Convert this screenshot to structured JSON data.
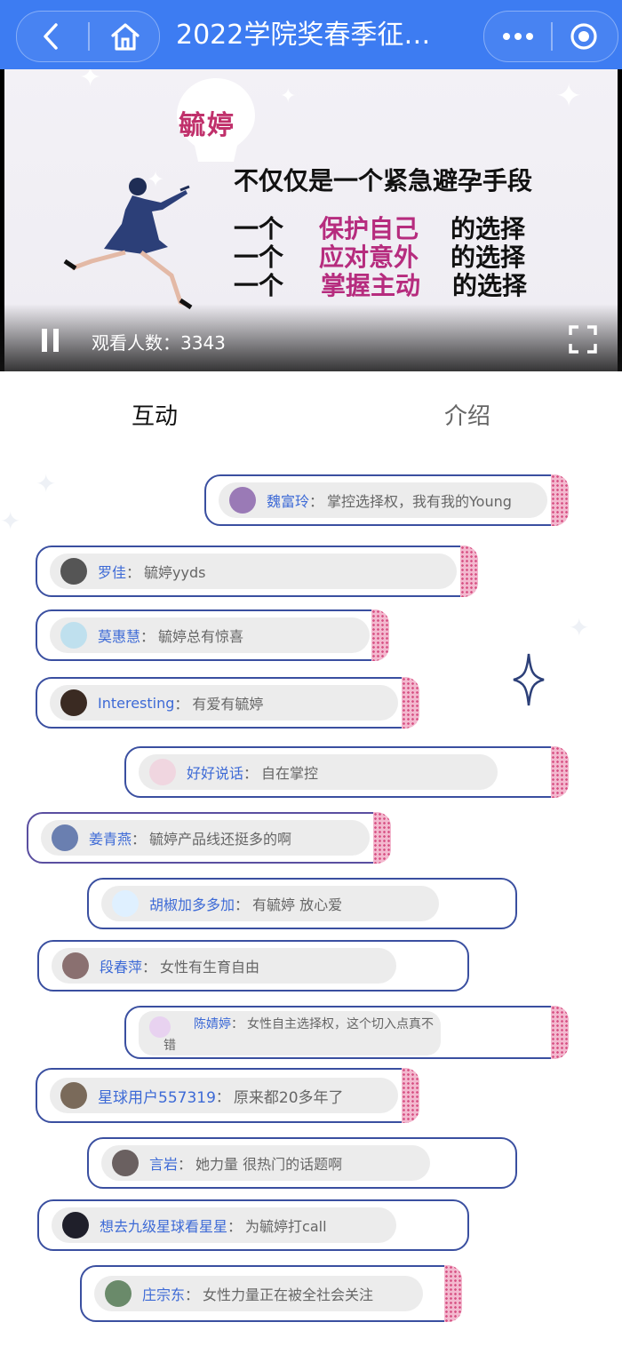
{
  "header": {
    "title": "2022学院奖春季征…",
    "icons": [
      "back-icon",
      "home-icon",
      "more-icon",
      "target-icon"
    ],
    "color": "#3d7cf2"
  },
  "video": {
    "bulb_text": "毓婷",
    "headline": "不仅仅是一个紧急避孕手段",
    "lines": [
      {
        "prefix": "一个",
        "highlight": "保护自己",
        "suffix": "的选择"
      },
      {
        "prefix": "一个",
        "highlight": "应对意外",
        "suffix": "的选择"
      },
      {
        "prefix": "一个",
        "highlight": "掌握主动",
        "suffix": "的选择"
      }
    ],
    "viewers": "观看人数：3343",
    "highlight_color": "#b62c7e"
  },
  "tabs": [
    {
      "label": "互动",
      "active": true
    },
    {
      "label": "介绍",
      "active": false
    }
  ],
  "comments": [
    {
      "user": "魏富玲",
      "sep": "：",
      "text": "掌控选择权，我有我的Young"
    },
    {
      "user": "罗佳",
      "sep": "：",
      "text": "毓婷yyds"
    },
    {
      "user": "莫惠慧",
      "sep": "：",
      "text": "毓婷总有惊喜"
    },
    {
      "user": "Interesting",
      "sep": "：",
      "text": "有爱有毓婷"
    },
    {
      "user": "好好说话",
      "sep": "：",
      "text": "自在掌控"
    },
    {
      "user": "姜青燕",
      "sep": "：",
      "text": "毓婷产品线还挺多的啊"
    },
    {
      "user": "胡椒加多多加",
      "sep": "：",
      "text": "有毓婷 放心爱"
    },
    {
      "user": "段春萍",
      "sep": "：",
      "text": "女性有生育自由"
    },
    {
      "user": "陈婧婷",
      "sep": "：",
      "text": "女性自主选择权，这个切入点真不",
      "text2": "错"
    },
    {
      "user": "星球用户557319",
      "sep": "：",
      "text": "原来都20多年了"
    },
    {
      "user": "言岩",
      "sep": "：",
      "text": "她力量 很热门的话题啊"
    },
    {
      "user": "想去九级星球看星星",
      "sep": "：",
      "text": "为毓婷打call"
    },
    {
      "user": "庄宗东",
      "sep": "：",
      "text": "女性力量正在被全社会关注"
    }
  ]
}
